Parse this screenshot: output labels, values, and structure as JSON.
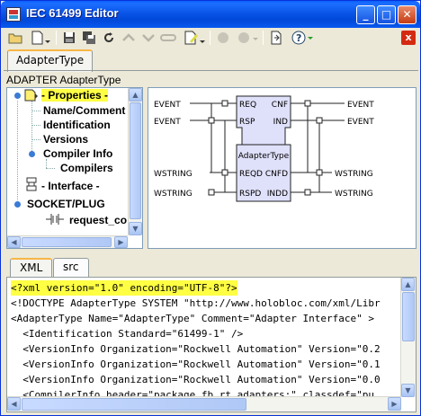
{
  "window": {
    "title": "IEC 61499 Editor",
    "minimize_label": "_",
    "maximize_label": "□",
    "close_label": "✕"
  },
  "toolbar": {
    "icons": [
      "open-folder-icon",
      "new-document-icon",
      "save-icon",
      "save-all-icon",
      "refresh-icon",
      "move-up-icon",
      "move-down-icon",
      "new-type-icon",
      "edit-icon",
      "stop-icon",
      "run-icon",
      "document-icon",
      "help-icon",
      "close-icon"
    ],
    "close_label": "x"
  },
  "tabs": [
    {
      "label": "AdapterType",
      "active": true
    }
  ],
  "header": {
    "adapter_label": "ADAPTER AdapterType"
  },
  "tree": {
    "nodes": [
      {
        "label": "- Properties -",
        "selected": true
      },
      {
        "label": "Name/Comment"
      },
      {
        "label": "Identification"
      },
      {
        "label": "Versions"
      },
      {
        "label": "Compiler Info"
      },
      {
        "label": "Compilers"
      },
      {
        "label": "- Interface -"
      },
      {
        "label": "SOCKET/PLUG"
      },
      {
        "label": "request_co"
      }
    ]
  },
  "diagram": {
    "block_name": "AdapterType",
    "left_events": [
      "EVENT",
      "EVENT"
    ],
    "right_events": [
      "EVENT",
      "EVENT"
    ],
    "left_data": [
      "WSTRING",
      "WSTRING"
    ],
    "right_data": [
      "WSTRING",
      "WSTRING"
    ],
    "inputs": [
      "REQ",
      "RSP",
      "REQD",
      "RSPD"
    ],
    "outputs": [
      "CNF",
      "IND",
      "CNFD",
      "INDD"
    ]
  },
  "bottom_tabs": [
    {
      "label": "XML",
      "active": true
    },
    {
      "label": "src",
      "active": false
    }
  ],
  "xml_lines": [
    "<?xml version=\"1.0\" encoding=\"UTF-8\"?>",
    "<!DOCTYPE AdapterType SYSTEM \"http://www.holobloc.com/xml/Libr",
    "<AdapterType Name=\"AdapterType\" Comment=\"Adapter Interface\" >",
    "  <Identification Standard=\"61499-1\" />",
    "  <VersionInfo Organization=\"Rockwell Automation\" Version=\"0.2",
    "  <VersionInfo Organization=\"Rockwell Automation\" Version=\"0.1",
    "  <VersionInfo Organization=\"Rockwell Automation\" Version=\"0.0",
    "  <CompilerInfo header=\"package fb.rt.adapters;\" classdef=\"pu"
  ]
}
